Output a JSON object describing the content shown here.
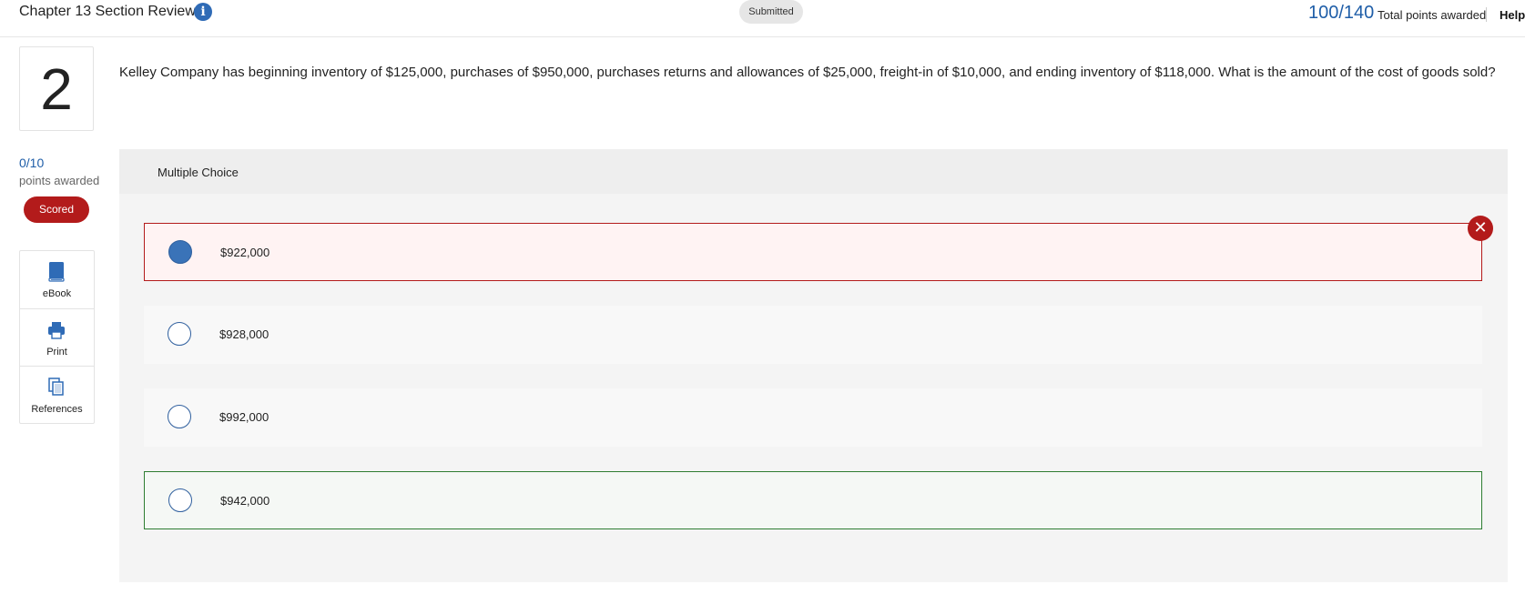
{
  "header": {
    "title": "Chapter 13 Section Review",
    "info_icon": "info-icon",
    "status": "Submitted",
    "score": "100/140",
    "score_caption": "Total points awarded",
    "help": "Help"
  },
  "question": {
    "number": "2",
    "text": "Kelley Company has beginning inventory of $125,000, purchases of $950,000, purchases returns and allowances of $25,000, freight-in of $10,000, and ending inventory of $118,000. What is the amount of the cost of goods sold?"
  },
  "score_panel": {
    "points": "0/10",
    "points_caption": "points awarded",
    "badge": "Scored"
  },
  "tools": [
    {
      "label": "eBook",
      "icon": "book-icon"
    },
    {
      "label": "Print",
      "icon": "printer-icon"
    },
    {
      "label": "References",
      "icon": "copy-icon"
    }
  ],
  "multiple_choice": {
    "type_label": "Multiple Choice",
    "options": [
      {
        "label": "$922,000",
        "selected": true,
        "state": "incorrect"
      },
      {
        "label": "$928,000",
        "selected": false,
        "state": "neutral"
      },
      {
        "label": "$992,000",
        "selected": false,
        "state": "neutral"
      },
      {
        "label": "$942,000",
        "selected": false,
        "state": "correct"
      }
    ],
    "wrong_icon": "close-icon"
  },
  "colors": {
    "accent": "#1f5ea8",
    "error": "#b31b1b",
    "correct": "#2e7d32",
    "selected_radio": "#3a73b8"
  }
}
